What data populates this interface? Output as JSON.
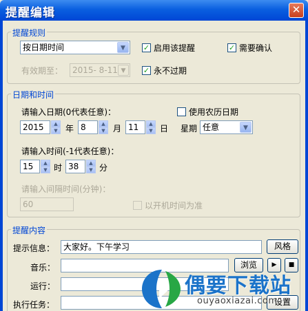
{
  "window": {
    "title": "提醒编辑",
    "close_glyph": "✕"
  },
  "rule": {
    "legend": "提醒规则",
    "mode": "按日期时间",
    "enable_label": "启用该提醒",
    "enable_checked": true,
    "confirm_label": "需要确认",
    "confirm_checked": true,
    "validity_label": "有效期至：",
    "validity_value": "2015- 8-11",
    "never_expire_label": "永不过期",
    "never_expire_checked": true
  },
  "datetime": {
    "legend": "日期和时间",
    "date_prompt": "请输入日期(0代表任意)：",
    "lunar_label": "使用农历日期",
    "lunar_checked": false,
    "year": "2015",
    "year_unit": "年",
    "month": "8",
    "month_unit": "月",
    "day": "11",
    "day_unit": "日",
    "weekday_label": "星期",
    "weekday": "任意",
    "time_prompt": "请输入时间(-1代表任意)：",
    "hour": "15",
    "hour_unit": "时",
    "minute": "38",
    "minute_unit": "分",
    "interval_prompt": "请输入间隔时间(分钟)：",
    "interval_value": "60",
    "boot_time_label": "以开机时间为准",
    "boot_time_checked": false
  },
  "content": {
    "legend": "提醒内容",
    "message_label": "提示信息：",
    "message_value": "大家好。下午学习",
    "style_button": "风格",
    "music_label": "音乐：",
    "music_value": "",
    "browse_button": "浏览",
    "run_label": "运行：",
    "run_value": "",
    "task_label": "执行任务：",
    "task_value": "",
    "setup_button": "设置"
  },
  "watermark": {
    "brand": "偶要下载站",
    "url": "ouyaoxiazai.com"
  },
  "colors": {
    "titlebar": "#0a5fe0",
    "legend": "#0046d5",
    "background": "#ece9d8",
    "check": "#21a121"
  }
}
